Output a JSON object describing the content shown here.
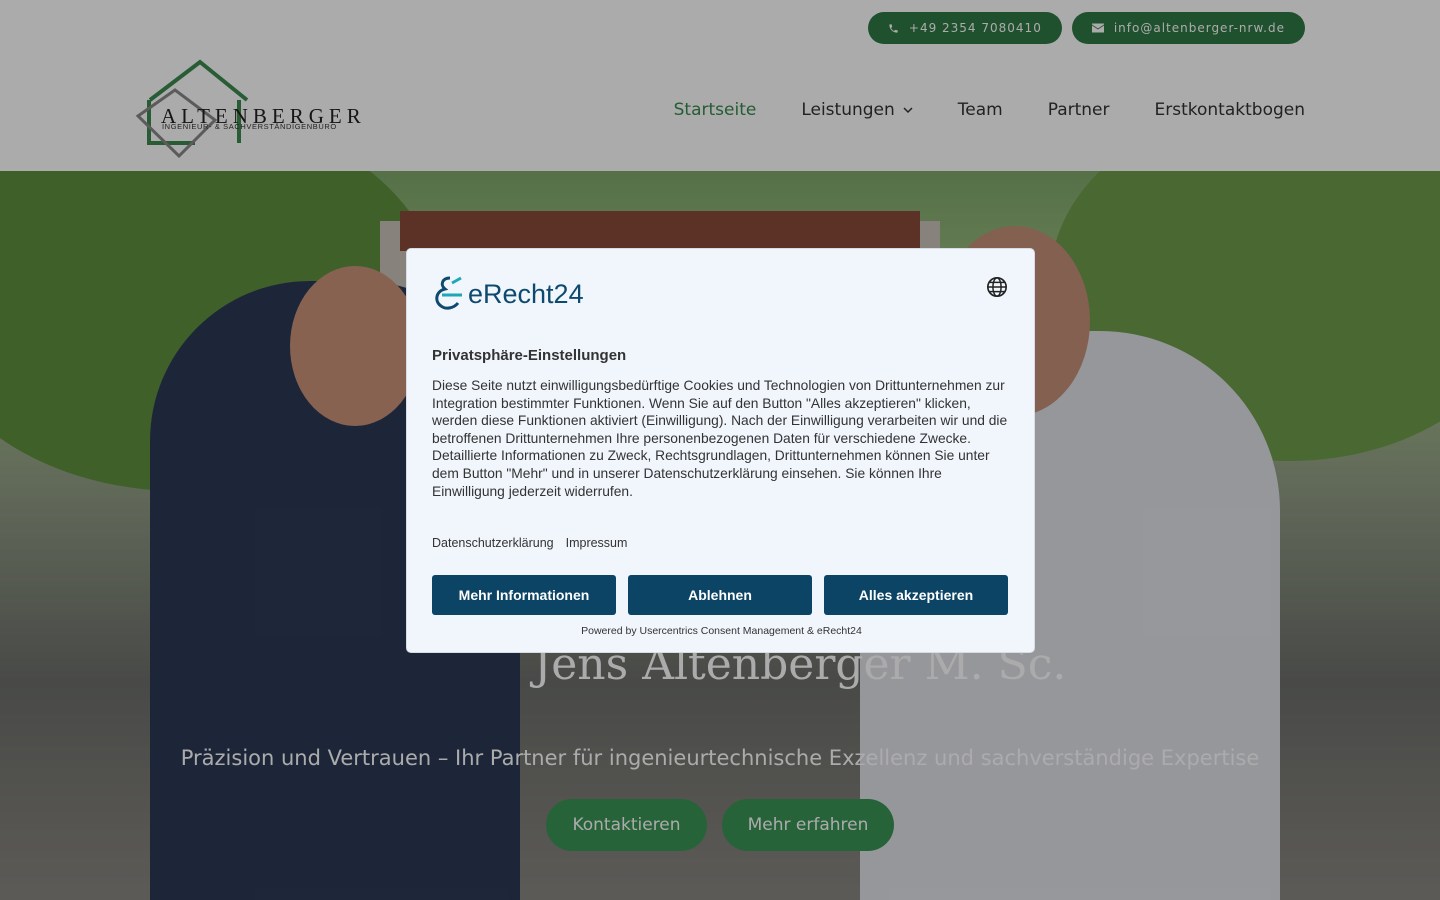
{
  "header": {
    "phone": "+49 2354 7080410",
    "email": "info@altenberger-nrw.de",
    "logo": {
      "name": "ALTENBERGER",
      "subtitle": "INGENIEUR- & SACHVERSTÄNDIGENBÜRO"
    },
    "nav": [
      {
        "label": "Startseite",
        "active": true
      },
      {
        "label": "Leistungen",
        "has_dropdown": true
      },
      {
        "label": "Team"
      },
      {
        "label": "Partner"
      },
      {
        "label": "Erstkontaktbogen"
      }
    ]
  },
  "hero": {
    "title_line1": "",
    "title_line2": "Jens Altenberger M. Sc.",
    "subtitle": "Präzision und Vertrauen – Ihr Partner für ingenieurtechnische Exzellenz und sachverständige Expertise",
    "buttons": [
      "Kontaktieren",
      "Mehr erfahren"
    ]
  },
  "consent": {
    "brand": "eRecht24",
    "title": "Privatsphäre-Einstellungen",
    "text": "Diese Seite nutzt einwilligungsbedürftige Cookies und Technologien von Drittunternehmen zur Integration bestimmter Funktionen. Wenn Sie auf den Button \"Alles akzeptieren\" klicken, werden diese Funktionen aktiviert (Einwilligung). Nach der Einwilligung verarbeiten wir und die betroffenen Drittunternehmen Ihre personenbezogenen Daten für verschiedene Zwecke. Detaillierte Informationen zu Zweck, Rechtsgrundlagen, Drittunternehmen können Sie unter dem Button \"Mehr\" und in unserer Datenschutzerklärung einsehen. Sie können Ihre Einwilligung jederzeit widerrufen.",
    "links": [
      "Datenschutzerklärung",
      "Impressum"
    ],
    "buttons": [
      "Mehr Informationen",
      "Ablehnen",
      "Alles akzeptieren"
    ],
    "powered": "Powered by Usercentrics Consent Management & eRecht24"
  },
  "colors": {
    "brand_green": "#2f7a45",
    "nav_active": "#3a8a50",
    "consent_button": "#0b4465",
    "consent_bg": "#f1f6fd"
  }
}
